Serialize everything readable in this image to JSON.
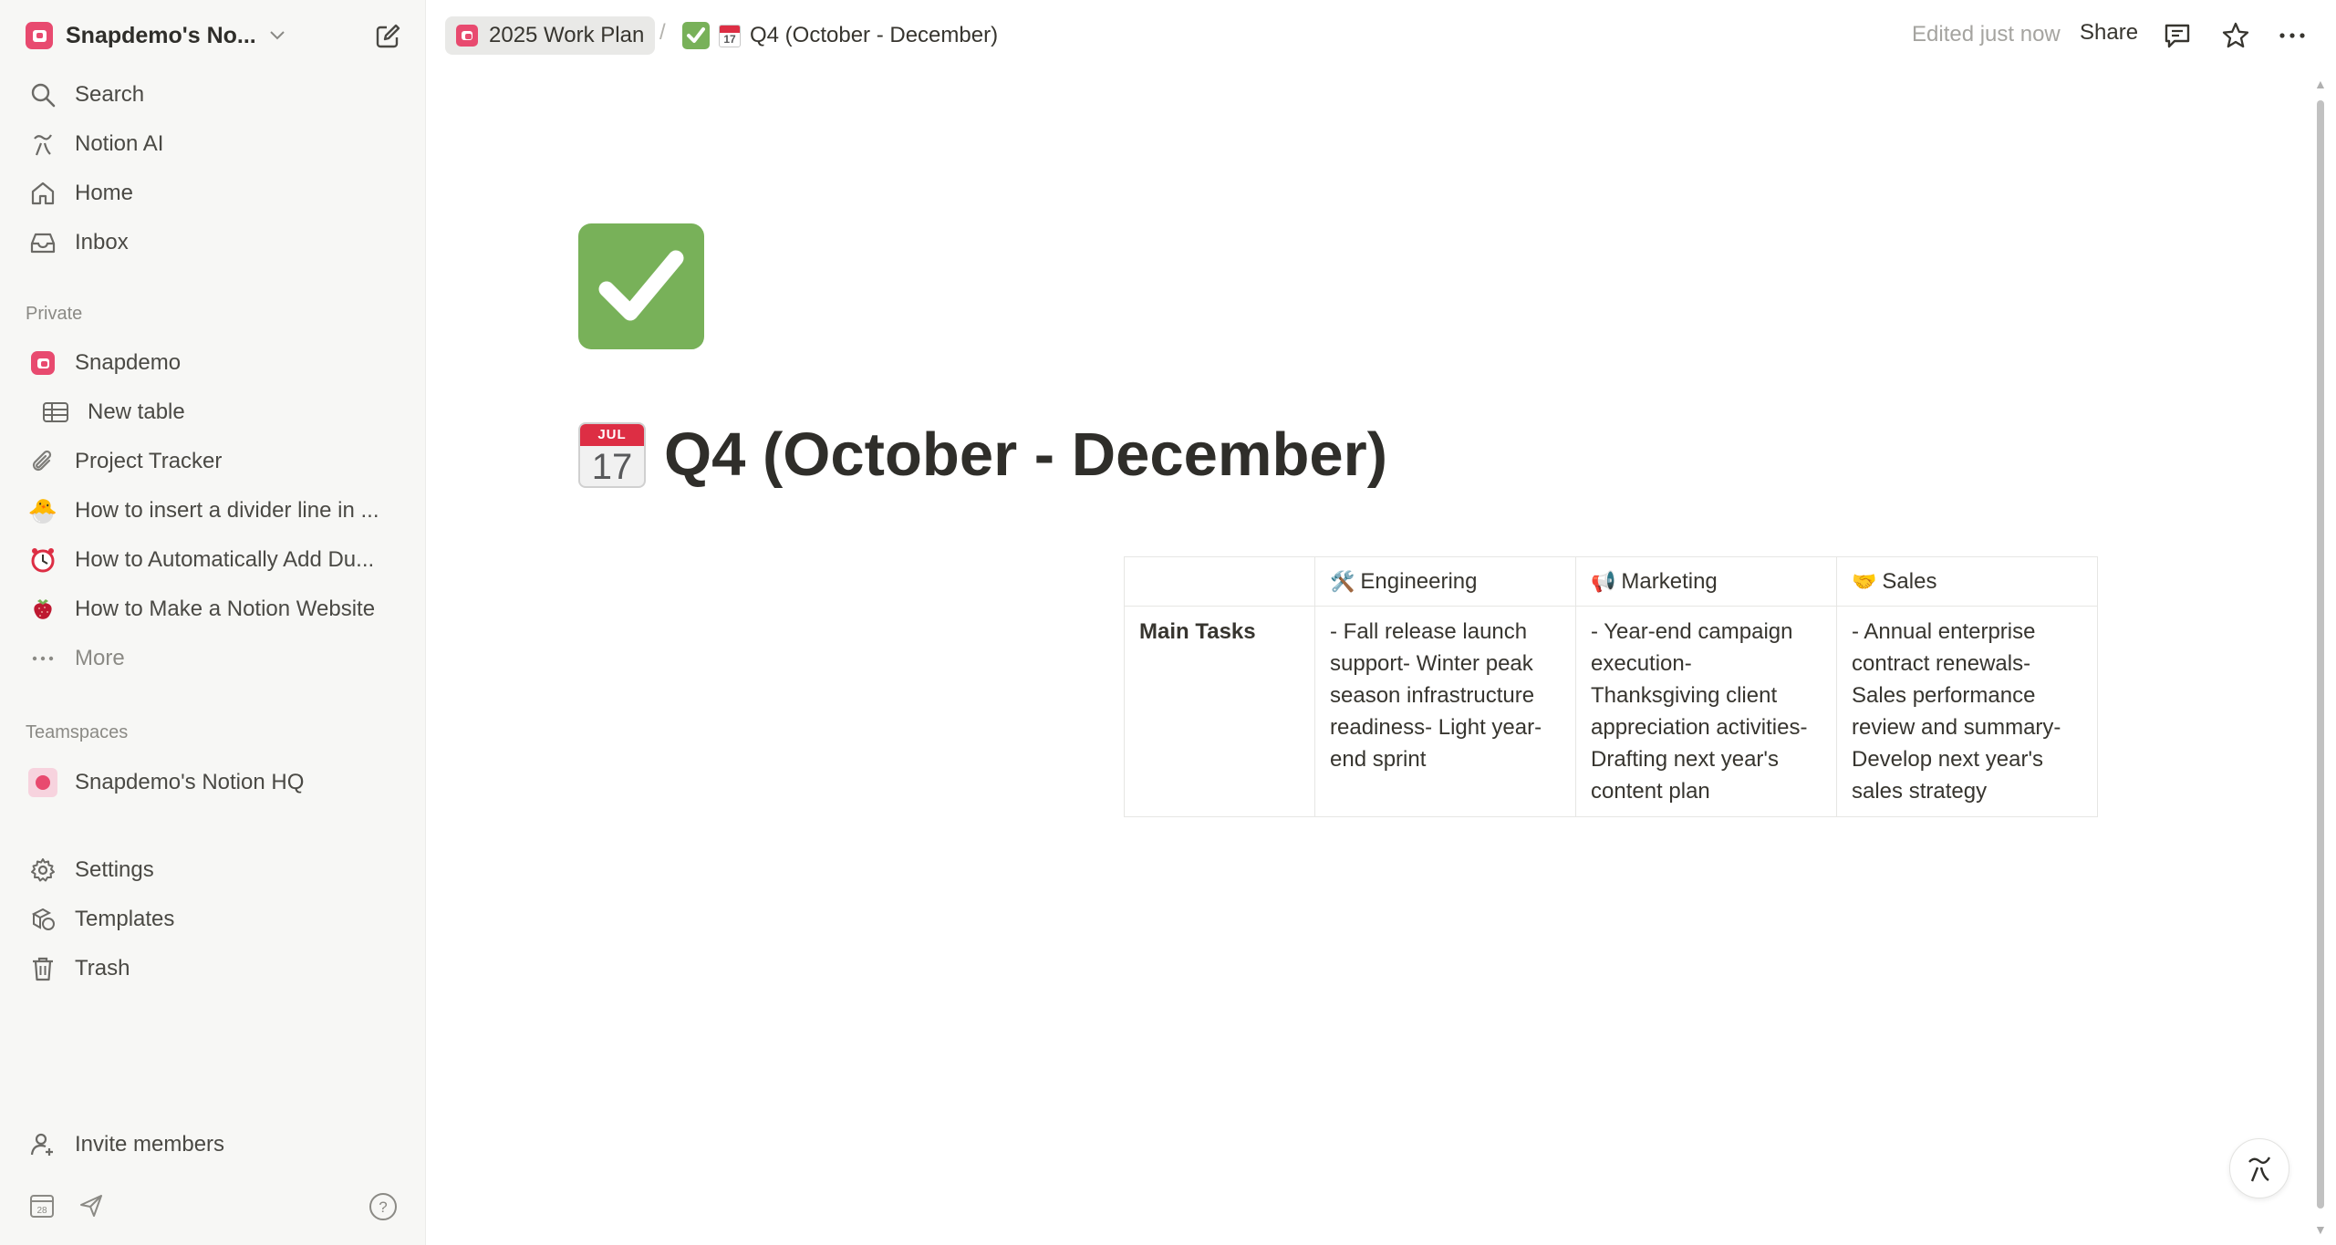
{
  "sidebar": {
    "workspace_name": "Snapdemo's No...",
    "nav": [
      {
        "label": "Search",
        "icon": "search-icon"
      },
      {
        "label": "Notion AI",
        "icon": "notion-ai-icon"
      },
      {
        "label": "Home",
        "icon": "home-icon"
      },
      {
        "label": "Inbox",
        "icon": "inbox-icon"
      }
    ],
    "private_label": "Private",
    "private_pages": [
      {
        "label": "Snapdemo",
        "icon": "snapdemo-logo-icon"
      },
      {
        "label": "New table",
        "icon": "table-icon"
      },
      {
        "label": "Project Tracker",
        "icon": "paperclip-icon"
      },
      {
        "label": "How to insert a divider line in ...",
        "icon": "chick-emoji-icon"
      },
      {
        "label": "How to Automatically Add Du...",
        "icon": "alarm-clock-emoji-icon"
      },
      {
        "label": "How to Make a Notion Website",
        "icon": "strawberry-emoji-icon"
      },
      {
        "label": "More",
        "icon": "ellipsis-icon"
      }
    ],
    "teamspaces_label": "Teamspaces",
    "teamspace": {
      "label": "Snapdemo's Notion HQ",
      "icon": "teamspace-logo-icon"
    },
    "bottom_nav": [
      {
        "label": "Settings",
        "icon": "gear-icon"
      },
      {
        "label": "Templates",
        "icon": "templates-icon"
      },
      {
        "label": "Trash",
        "icon": "trash-icon"
      }
    ],
    "invite_label": "Invite members"
  },
  "topbar": {
    "breadcrumb_parent": "2025 Work Plan",
    "breadcrumb_sep": "/",
    "breadcrumb_current": "Q4 (October - December)",
    "edited": "Edited just now",
    "share": "Share"
  },
  "page": {
    "title": "Q4 (October - December)",
    "calendar_month": "JUL",
    "calendar_day": "17"
  },
  "table": {
    "headers": [
      {
        "label": "",
        "emoji": ""
      },
      {
        "label": "Engineering",
        "emoji": "🛠️"
      },
      {
        "label": "Marketing",
        "emoji": "📢"
      },
      {
        "label": "Sales",
        "emoji": "🤝"
      }
    ],
    "rows": [
      {
        "label": "Main Tasks",
        "cells": [
          "- Fall release launch support- Winter peak season infrastructure readiness- Light year-end sprint",
          "- Year-end campaign execution- Thanksgiving client appreciation activities- Drafting next year's content plan",
          "- Annual enterprise contract renewals- Sales performance review and summary- Develop next year's sales strategy"
        ]
      }
    ]
  },
  "colors": {
    "accent_pink": "#e84a6f",
    "check_green": "#78b159",
    "sidebar_bg": "#f7f7f5"
  }
}
